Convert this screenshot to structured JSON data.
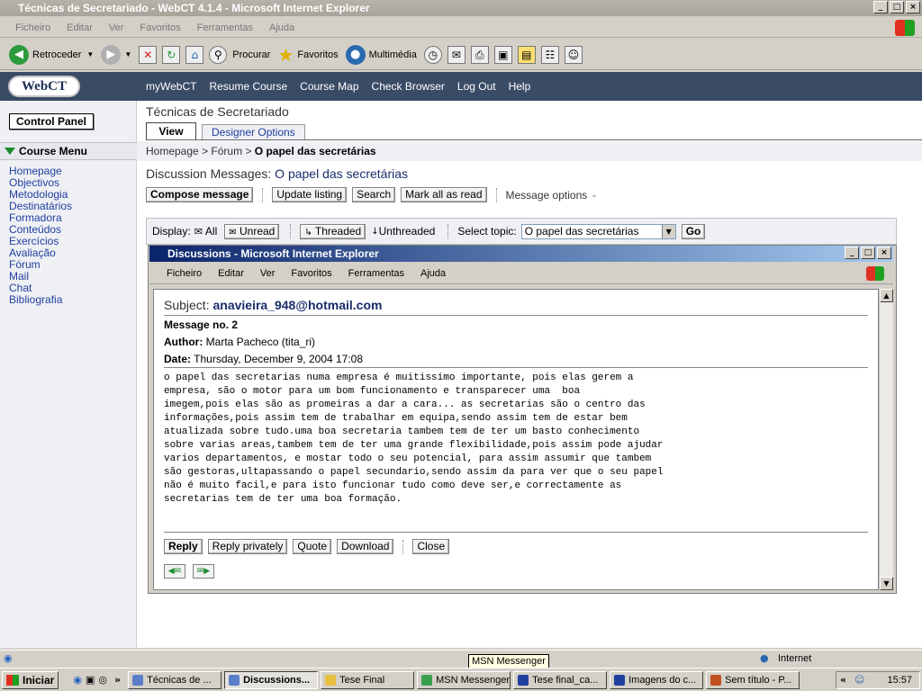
{
  "window": {
    "title": "Técnicas de Secretariado - WebCT 4.1.4 - Microsoft Internet Explorer",
    "controls": [
      "_",
      "□",
      "×"
    ]
  },
  "ie_menu": [
    "Ficheiro",
    "Editar",
    "Ver",
    "Favoritos",
    "Ferramentas",
    "Ajuda"
  ],
  "ie_toolbar": {
    "back": "Retroceder",
    "search": "Procurar",
    "favorites": "Favoritos",
    "media": "Multimédia"
  },
  "webct": {
    "logo": "WebCT",
    "nav": [
      "myWebCT",
      "Resume Course",
      "Course Map",
      "Check Browser",
      "Log Out",
      "Help"
    ],
    "control_panel": "Control Panel",
    "course_menu_title": "Course Menu",
    "course_menu": [
      "Homepage",
      "Objectivos",
      "Metodologia",
      "Destinatários",
      "Formadora",
      "Conteúdos",
      "Exercícios",
      "Avaliação",
      "Fórum",
      "Mail",
      "Chat",
      "Bibliografia"
    ],
    "course_title": "Técnicas de Secretariado",
    "tabs": {
      "view": "View",
      "designer": "Designer Options"
    },
    "breadcrumb": {
      "home": "Homepage",
      "sep": ">",
      "forum": "Fórum",
      "current": "O papel das secretárias"
    },
    "dm_label": "Discussion Messages:",
    "dm_topic": "O papel das secretárias",
    "actions": {
      "compose": "Compose message",
      "update": "Update listing",
      "search": "Search",
      "mark_read": "Mark all as read",
      "options": "Message options"
    },
    "display": {
      "label": "Display:",
      "all": "All",
      "unread": "Unread",
      "threaded": "Threaded",
      "unthreaded": "Unthreaded",
      "select_topic_label": "Select topic:",
      "topic_value": "O papel das secretárias",
      "go": "Go"
    }
  },
  "popup": {
    "title": "Discussions - Microsoft Internet Explorer",
    "menu": [
      "Ficheiro",
      "Editar",
      "Ver",
      "Favoritos",
      "Ferramentas",
      "Ajuda"
    ],
    "subject_label": "Subject:",
    "subject": "anavieira_948@hotmail.com",
    "msgno_label": "Message no.",
    "msgno": "2",
    "author_label": "Author:",
    "author": "Marta Pacheco (tita_ri)",
    "date_label": "Date:",
    "date": "Thursday, December 9, 2004 17:08",
    "body": "o papel das secretarias numa empresa é muitissimo importante, pois elas gerem a\nempresa, são o motor para um bom funcionamento e transparecer uma  boa\nimegem,pois elas são as promeiras a dar a cara... as secretarias são o centro das\ninformações,pois assim tem de trabalhar em equipa,sendo assim tem de estar bem\natualizada sobre tudo.uma boa secretaria tambem tem de ter um basto conhecimento\nsobre varias areas,tambem tem de ter uma grande flexibilidade,pois assim pode ajudar\nvarios departamentos, e mostar todo o seu potencial, para assim assumir que tambem\nsão gestoras,ultapassando o papel secundario,sendo assim da para ver que o seu papel\nnão é muito facil,e para isto funcionar tudo como deve ser,e correctamente as\nsecretarias tem de ter uma boa formação.",
    "buttons": {
      "reply": "Reply",
      "reply_private": "Reply privately",
      "quote": "Quote",
      "download": "Download",
      "close": "Close"
    }
  },
  "status": {
    "zone": "Internet",
    "tooltip": "MSN Messenger"
  },
  "taskbar": {
    "start": "Iniciar",
    "tasks": [
      "Técnicas de ...",
      "Discussions...",
      "Tese Final",
      "MSN Messenger",
      "Tese final_ca...",
      "Imagens do c...",
      "Sem título - P..."
    ],
    "clock": "15:57"
  }
}
